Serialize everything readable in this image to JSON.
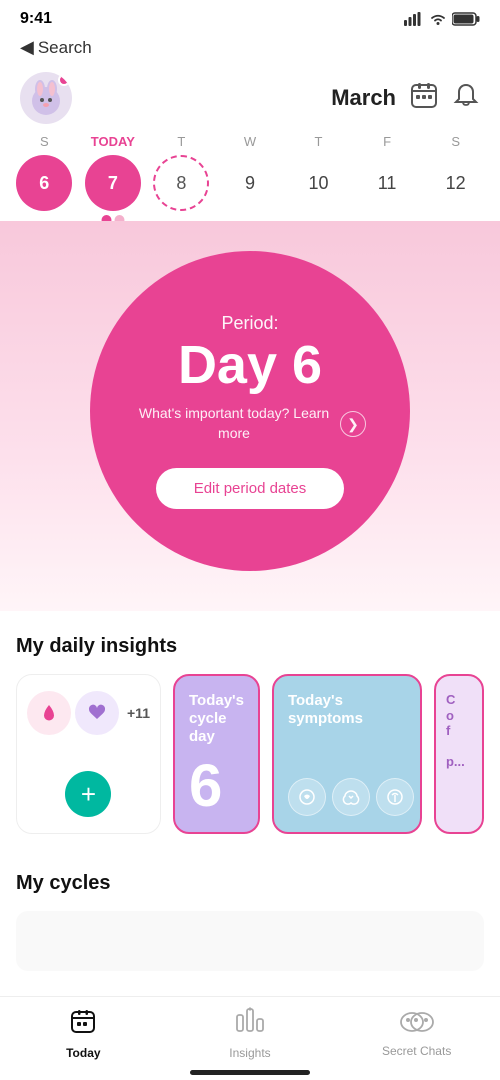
{
  "statusBar": {
    "time": "9:41",
    "moonIcon": "🌙"
  },
  "nav": {
    "backLabel": "Search"
  },
  "header": {
    "monthLabel": "March",
    "calendarIcon": "📅",
    "bellIcon": "🔔"
  },
  "calendar": {
    "dayLetters": [
      "S",
      "TODAY",
      "T",
      "W",
      "T",
      "F",
      "S"
    ],
    "days": [
      "6",
      "7",
      "8",
      "9",
      "10",
      "11",
      "12"
    ],
    "dayStates": [
      "period",
      "today",
      "ring",
      "normal",
      "normal",
      "normal",
      "normal"
    ]
  },
  "mainCircle": {
    "periodLabel": "Period:",
    "dayLabel": "Day 6",
    "learnMoreText": "What's important today? Learn more",
    "editButtonLabel": "Edit period dates"
  },
  "insightsSection": {
    "title": "My daily insights",
    "card1": {
      "plusCount": "+11",
      "plusButtonLabel": "+"
    },
    "card2": {
      "label": "Today's cycle day",
      "number": "6"
    },
    "card3": {
      "label": "Today's symptoms"
    },
    "card4": {
      "label": "C..."
    }
  },
  "cyclesSection": {
    "title": "My cycles"
  },
  "bottomNav": {
    "items": [
      {
        "label": "Today",
        "active": true
      },
      {
        "label": "Insights",
        "active": false
      },
      {
        "label": "Secret Chats",
        "active": false
      }
    ]
  }
}
